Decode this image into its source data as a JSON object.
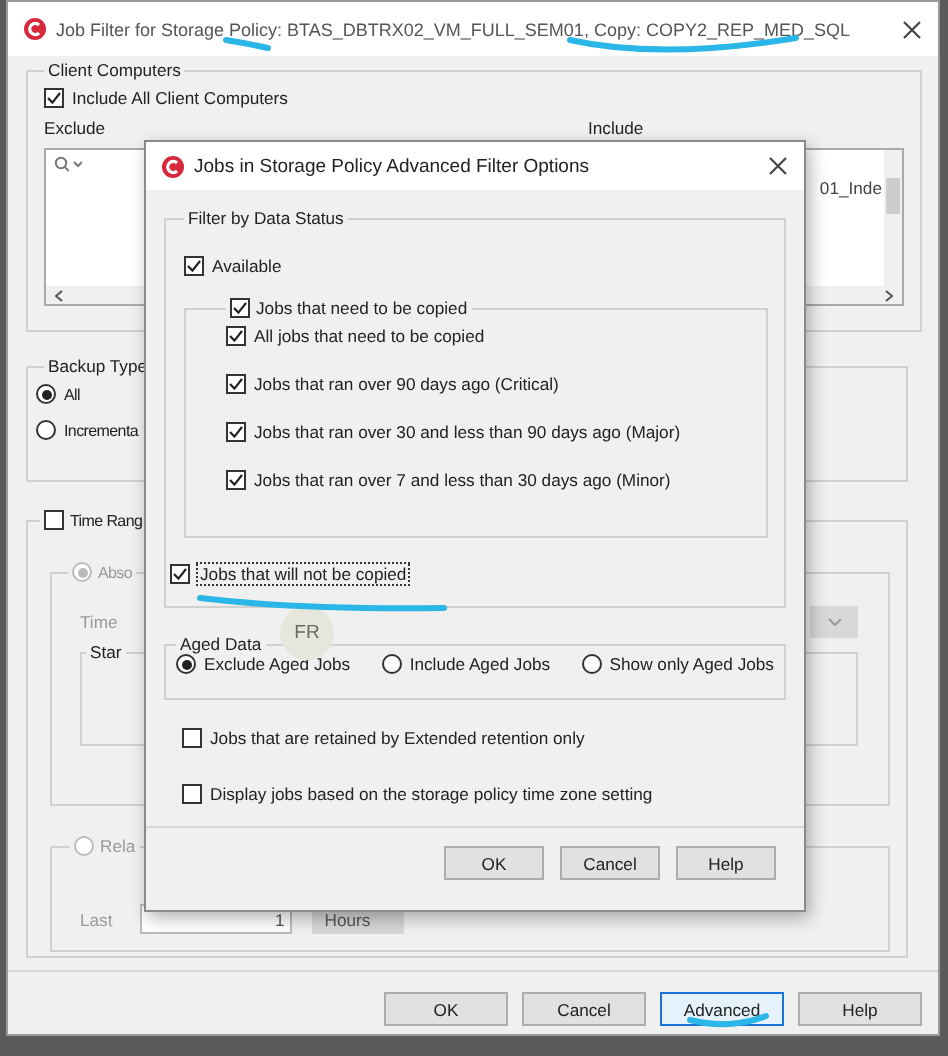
{
  "window": {
    "title": "Job Filter for Storage Policy: BTAS_DBTRX02_VM_FULL_SEM01, Copy: COPY2_REP_MED_SQL"
  },
  "client_computers": {
    "title": "Client Computers",
    "include_all": {
      "label": "Include All Client Computers",
      "checked": true
    },
    "exclude_label": "Exclude",
    "include_label": "Include",
    "include_items": [
      "01_Inde"
    ]
  },
  "backup_type": {
    "title": "Backup Type",
    "options": [
      {
        "label": "All",
        "selected": true
      },
      {
        "label": "Incrementa",
        "selected": false
      }
    ]
  },
  "time_range": {
    "label": "Time Rang",
    "checked": false,
    "absolute": {
      "label": "Abso",
      "selected": true,
      "disabled": true,
      "time_label": "Time",
      "start_label": "Star"
    },
    "relative": {
      "label": "Rela",
      "selected": false,
      "disabled": true,
      "last_label": "Last",
      "amount": "1",
      "unit": "Hours"
    }
  },
  "buttons": [
    {
      "label": "OK",
      "focused": false
    },
    {
      "label": "Cancel",
      "focused": false
    },
    {
      "label": "Advanced",
      "focused": true
    },
    {
      "label": "Help",
      "focused": false
    }
  ],
  "dialog": {
    "title": "Jobs in Storage Policy Advanced Filter Options",
    "data_status": {
      "title": "Filter by Data Status",
      "available": {
        "label": "Available",
        "checked": true
      },
      "need_copy": {
        "label": "Jobs that need to be copied",
        "checked": true,
        "items": [
          {
            "label": "All jobs that need to be copied",
            "checked": true
          },
          {
            "label": "Jobs that ran over 90 days ago (Critical)",
            "checked": true
          },
          {
            "label": "Jobs that ran over 30 and less than 90 days ago (Major)",
            "checked": true
          },
          {
            "label": "Jobs that ran over 7 and less than 30 days ago (Minor)",
            "checked": true
          }
        ]
      },
      "not_copied": {
        "label": "Jobs that will not be copied",
        "checked": true,
        "focused": true
      }
    },
    "aged_data": {
      "title": "Aged Data",
      "options": [
        {
          "label": "Exclude Aged Jobs",
          "selected": true
        },
        {
          "label": "Include Aged Jobs",
          "selected": false
        },
        {
          "label": "Show only Aged Jobs",
          "selected": false
        }
      ]
    },
    "options": [
      {
        "label": "Jobs that are retained by Extended retention only",
        "checked": false
      },
      {
        "label": "Display jobs based on the storage policy time zone setting",
        "checked": false
      }
    ],
    "buttons": [
      {
        "label": "OK"
      },
      {
        "label": "Cancel"
      },
      {
        "label": "Help"
      }
    ]
  },
  "overlay_badge": {
    "initials": "FR"
  }
}
